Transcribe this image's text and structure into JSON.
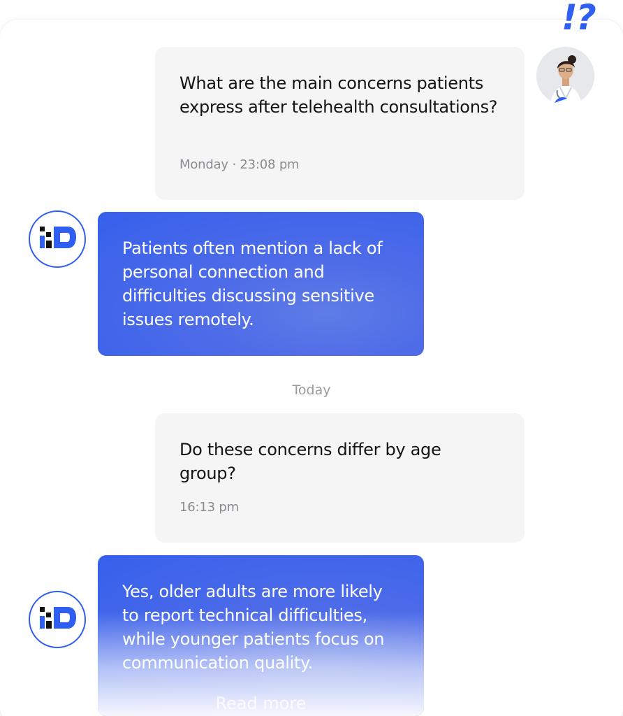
{
  "header": {
    "badge": "!?"
  },
  "conversation": {
    "divider_label": "Today",
    "messages": [
      {
        "role": "user",
        "text": "What are the main concerns patients express after telehealth consultations?",
        "time": "Monday · 23:08 pm"
      },
      {
        "role": "assistant",
        "text": "Patients often mention a lack of personal connection and difficulties discussing sensitive issues remotely."
      },
      {
        "role": "user",
        "text": "Do these concerns differ by age group?",
        "time": "16:13 pm"
      },
      {
        "role": "assistant",
        "text": "Yes, older adults are more likely to report technical difficulties, while younger patients focus on communication quality.",
        "action": "Read more"
      }
    ]
  },
  "colors": {
    "accent": "#2f5ff0",
    "user_bubble": "#f5f5f6",
    "bot_bubble": "#3560ec"
  },
  "icons": {
    "user_avatar": "doctor-avatar",
    "bot_avatar": "io-logo-icon"
  }
}
